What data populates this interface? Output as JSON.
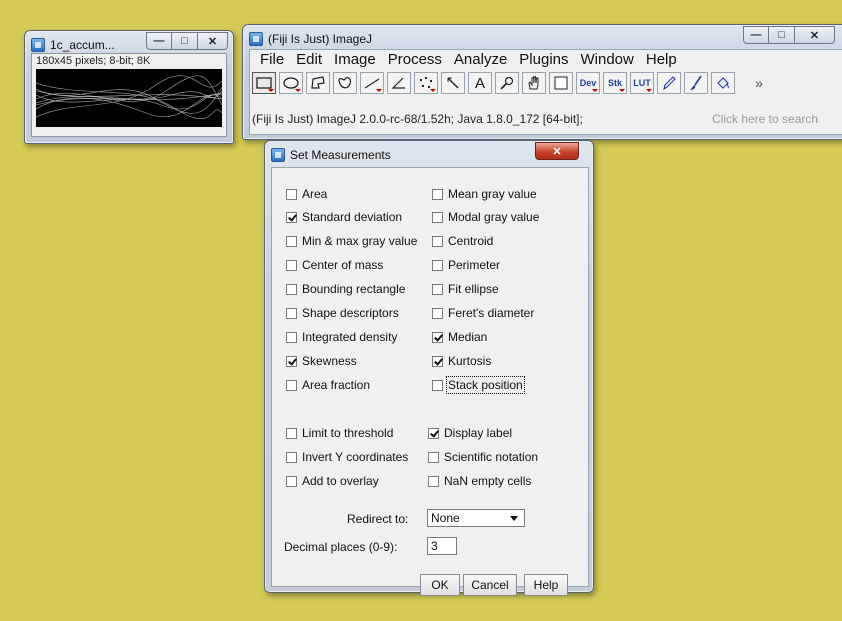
{
  "image_window": {
    "title": "1c_accum...",
    "info": "180x45 pixels; 8-bit; 8K"
  },
  "main_window": {
    "title": "(Fiji Is Just) ImageJ",
    "menu": [
      "File",
      "Edit",
      "Image",
      "Process",
      "Analyze",
      "Plugins",
      "Window",
      "Help"
    ],
    "tools": [
      {
        "icon": "rectangle-tool-icon"
      },
      {
        "icon": "oval-tool-icon"
      },
      {
        "icon": "polygon-tool-icon"
      },
      {
        "icon": "freehand-tool-icon"
      },
      {
        "icon": "line-tool-icon"
      },
      {
        "icon": "angle-tool-icon"
      },
      {
        "icon": "multipoint-tool-icon"
      },
      {
        "icon": "wand-tool-icon"
      },
      {
        "icon": "text-tool-icon",
        "text": "A"
      },
      {
        "icon": "magnifier-tool-icon"
      },
      {
        "icon": "hand-tool-icon"
      },
      {
        "icon": "color-picker-tool-icon"
      },
      {
        "icon": "dev-menu-icon",
        "text": "Dev"
      },
      {
        "icon": "stk-menu-icon",
        "text": "Stk"
      },
      {
        "icon": "lut-menu-icon",
        "text": "LUT"
      },
      {
        "icon": "pencil-tool-icon"
      },
      {
        "icon": "brush-tool-icon"
      },
      {
        "icon": "flood-fill-tool-icon"
      },
      {
        "icon": "more-tools-icon",
        "text": "»"
      }
    ],
    "status": "(Fiji Is Just) ImageJ 2.0.0-rc-68/1.52h; Java 1.8.0_172 [64-bit];",
    "search_hint": "Click here to search"
  },
  "dialog": {
    "title": "Set Measurements",
    "left_options": [
      {
        "label": "Area",
        "checked": false
      },
      {
        "label": "Standard deviation",
        "checked": true
      },
      {
        "label": "Min & max gray value",
        "checked": false
      },
      {
        "label": "Center of mass",
        "checked": false
      },
      {
        "label": "Bounding rectangle",
        "checked": false
      },
      {
        "label": "Shape descriptors",
        "checked": false
      },
      {
        "label": "Integrated density",
        "checked": false
      },
      {
        "label": "Skewness",
        "checked": true
      },
      {
        "label": "Area fraction",
        "checked": false
      }
    ],
    "right_options": [
      {
        "label": "Mean gray value",
        "checked": false
      },
      {
        "label": "Modal gray value",
        "checked": false
      },
      {
        "label": "Centroid",
        "checked": false
      },
      {
        "label": "Perimeter",
        "checked": false
      },
      {
        "label": "Fit ellipse",
        "checked": false
      },
      {
        "label": "Feret's diameter",
        "checked": false
      },
      {
        "label": "Median",
        "checked": true
      },
      {
        "label": "Kurtosis",
        "checked": true
      },
      {
        "label": "Stack position",
        "checked": false
      }
    ],
    "left_extra": [
      {
        "label": "Limit to threshold",
        "checked": false
      },
      {
        "label": "Invert Y coordinates",
        "checked": false
      },
      {
        "label": "Add to overlay",
        "checked": false
      }
    ],
    "right_extra": [
      {
        "label": "Display label",
        "checked": true
      },
      {
        "label": "Scientific notation",
        "checked": false
      },
      {
        "label": "NaN empty cells",
        "checked": false
      }
    ],
    "redirect_label": "Redirect to:",
    "redirect_value": "None",
    "decimal_label": "Decimal places (0-9):",
    "decimal_value": "3",
    "ok": "OK",
    "cancel": "Cancel",
    "help": "Help"
  }
}
